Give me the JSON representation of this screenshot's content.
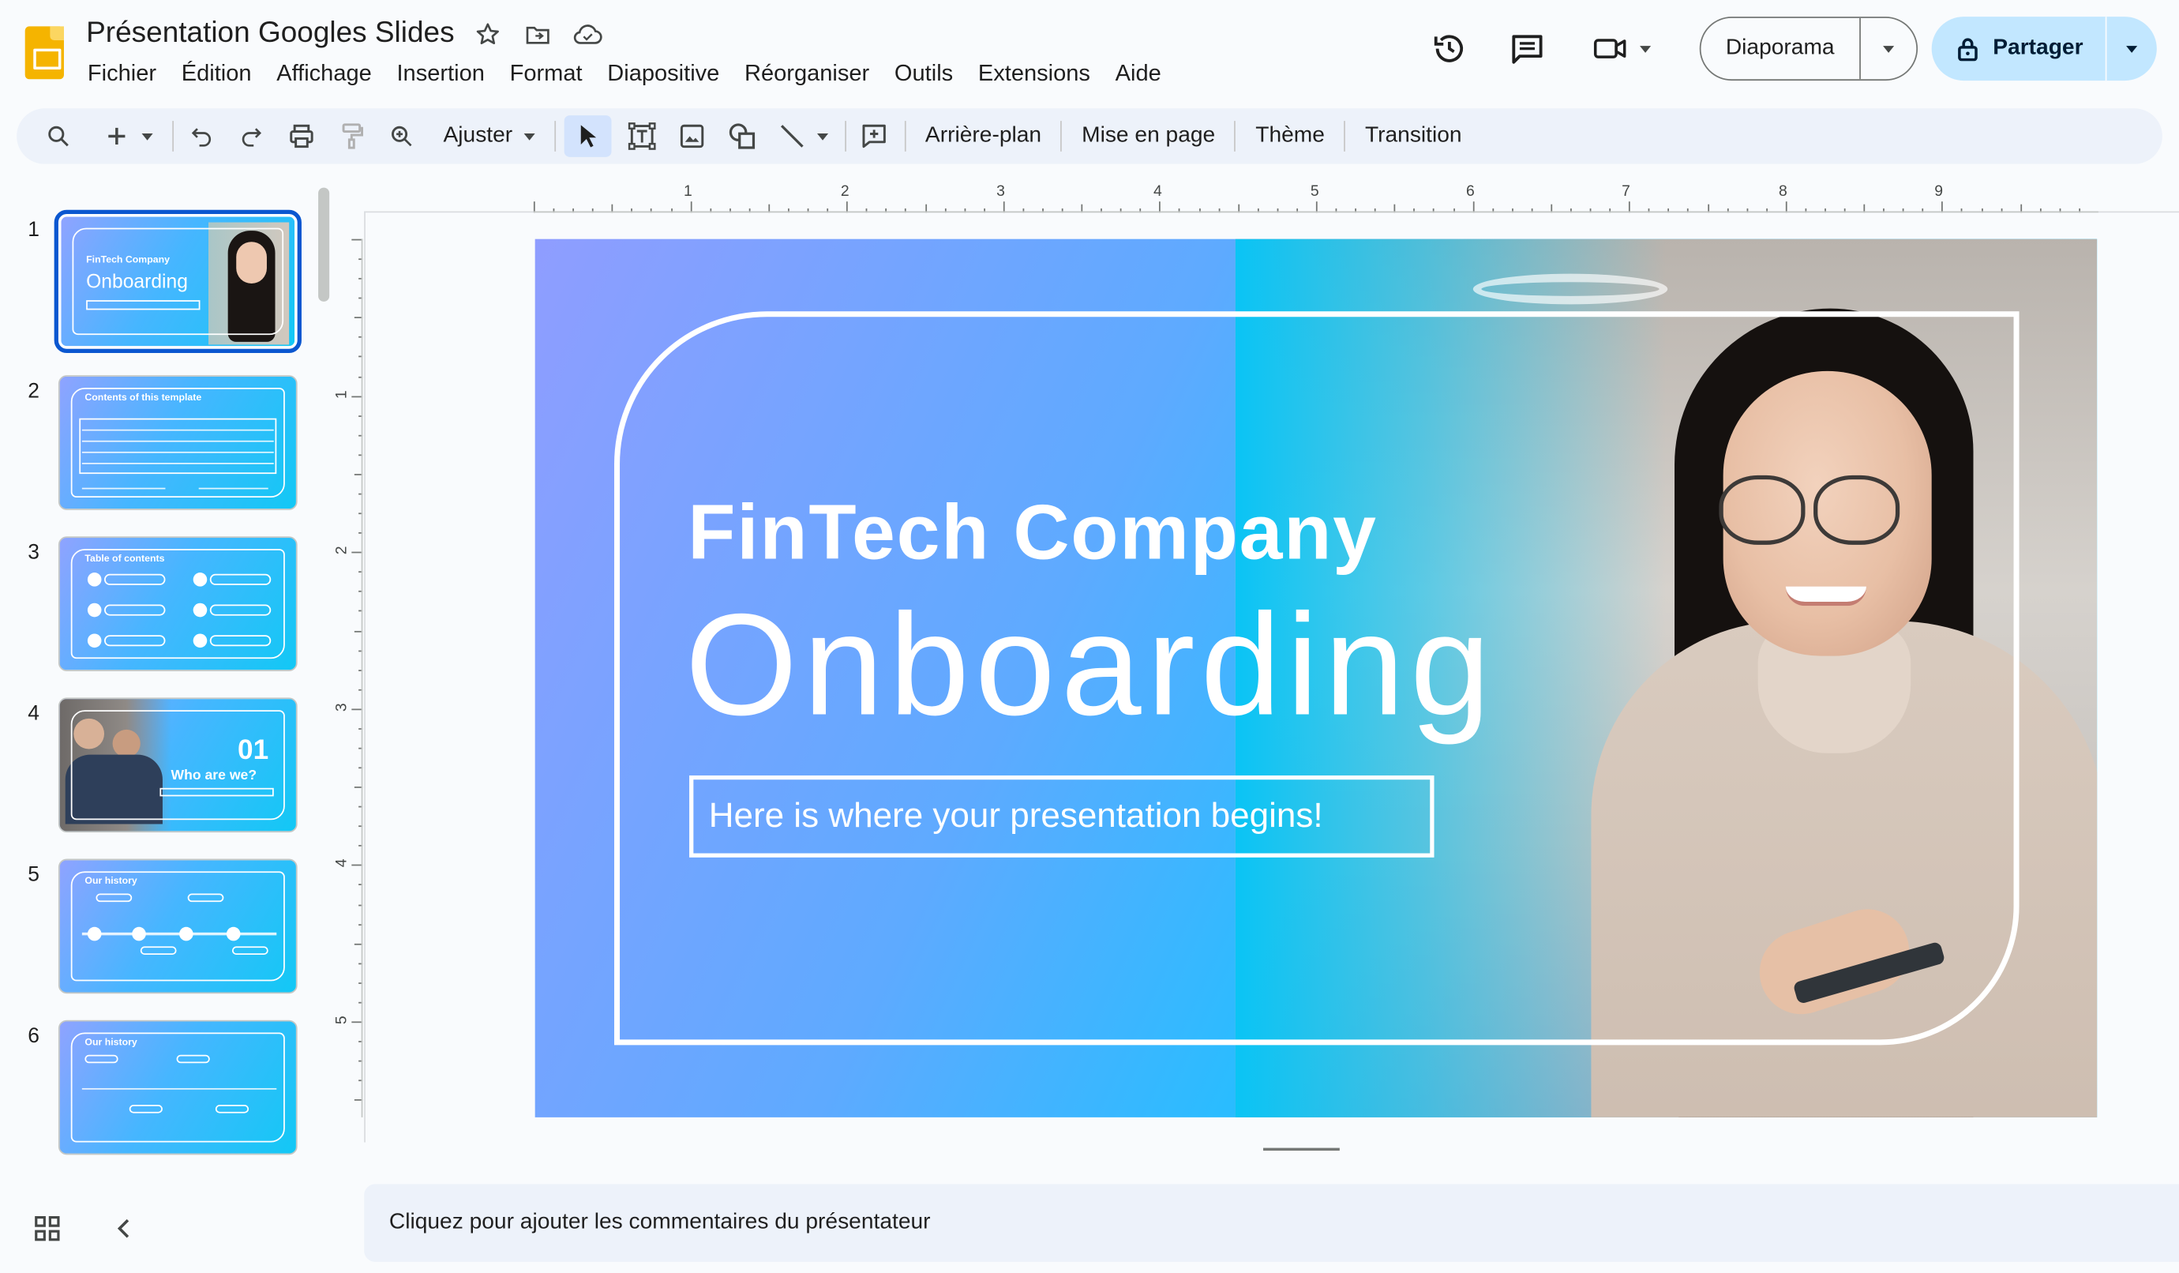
{
  "header": {
    "doc_title": "Présentation Googles Slides",
    "menu": [
      "Fichier",
      "Édition",
      "Affichage",
      "Insertion",
      "Format",
      "Diapositive",
      "Réorganiser",
      "Outils",
      "Extensions",
      "Aide"
    ],
    "slideshow_label": "Diaporama",
    "share_label": "Partager"
  },
  "toolbar": {
    "zoom_label": "Ajuster",
    "background_label": "Arrière-plan",
    "layout_label": "Mise en page",
    "theme_label": "Thème",
    "transition_label": "Transition"
  },
  "filmstrip": {
    "slides": [
      {
        "num": "1",
        "t1": "FinTech Company",
        "t2": "Onboarding"
      },
      {
        "num": "2",
        "t1": "Contents of this template"
      },
      {
        "num": "3",
        "t1": "Table of contents"
      },
      {
        "num": "4",
        "t1": "01",
        "t2": "Who are we?"
      },
      {
        "num": "5",
        "t1": "Our history"
      },
      {
        "num": "6",
        "t1": "Our history"
      }
    ],
    "active_index": 0
  },
  "ruler": {
    "h_numbers": [
      "1",
      "2",
      "3",
      "4",
      "5",
      "6",
      "7",
      "8",
      "9"
    ],
    "v_numbers": [
      "1",
      "2",
      "3",
      "4",
      "5"
    ]
  },
  "slide": {
    "title1": "FinTech Company",
    "title2": "Onboarding",
    "subtitle": "Here is where your presentation begins!"
  },
  "notes": {
    "placeholder": "Cliquez pour ajouter les commentaires du présentateur"
  },
  "colors": {
    "accent": "#0b57d0",
    "share_bg": "#c2e7ff",
    "toolbar_bg": "#edf2fa",
    "logo": "#f5b400"
  }
}
